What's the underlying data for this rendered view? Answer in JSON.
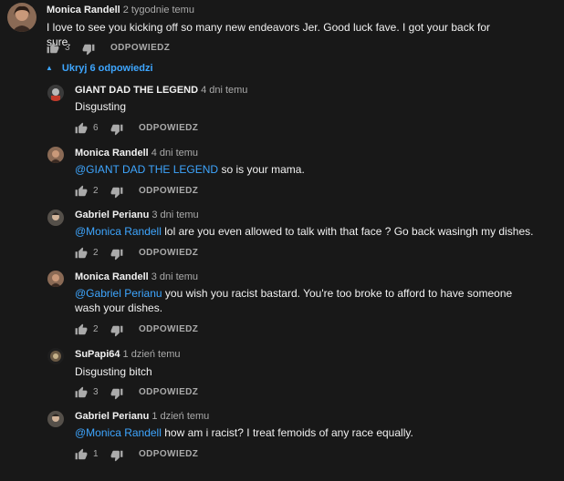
{
  "top_comment": {
    "author": "Monica Randell",
    "time": "2 tygodnie temu",
    "text": "I love to see you kicking off so many new endeavors Jer. Good luck fave. I got your back for sure.",
    "likes": "3",
    "reply_label": "ODPOWIEDZ"
  },
  "replies_toggle": "Ukryj 6 odpowiedzi",
  "replies": [
    {
      "author": "GIANT DAD THE LEGEND",
      "time": "4 dni temu",
      "mention": "",
      "text": "Disgusting",
      "likes": "6",
      "reply_label": "ODPOWIEDZ"
    },
    {
      "author": "Monica Randell",
      "time": "4 dni temu",
      "mention": "@GIANT DAD THE LEGEND",
      "text": " so is your mama.",
      "likes": "2",
      "reply_label": "ODPOWIEDZ"
    },
    {
      "author": "Gabriel Perianu",
      "time": "3 dni temu",
      "mention": "@Monica Randell",
      "text": " lol are you even allowed to talk with that face ? Go back wasingh my dishes.",
      "likes": "2",
      "reply_label": "ODPOWIEDZ"
    },
    {
      "author": "Monica Randell",
      "time": "3 dni temu",
      "mention": "@Gabriel Perianu",
      "text": " you wish you racist bastard. You're too broke to afford to have someone wash your dishes.",
      "likes": "2",
      "reply_label": "ODPOWIEDZ"
    },
    {
      "author": "SuPapi64",
      "time": "1 dzień temu",
      "mention": "",
      "text": "Disgusting bitch",
      "likes": "3",
      "reply_label": "ODPOWIEDZ"
    },
    {
      "author": "Gabriel Perianu",
      "time": "1 dzień temu",
      "mention": "@Monica Randell",
      "text": " how am  i racist?  I treat femoids of any race equally.",
      "likes": "1",
      "reply_label": "ODPOWIEDZ"
    }
  ],
  "icons": {
    "like": "thumbs-up-icon",
    "dislike": "thumbs-down-icon",
    "toggle": "caret-up-icon"
  },
  "colors": {
    "background": "#181818",
    "text": "#f1f1f1",
    "secondary": "#aaaaaa",
    "link": "#3ea6ff"
  }
}
